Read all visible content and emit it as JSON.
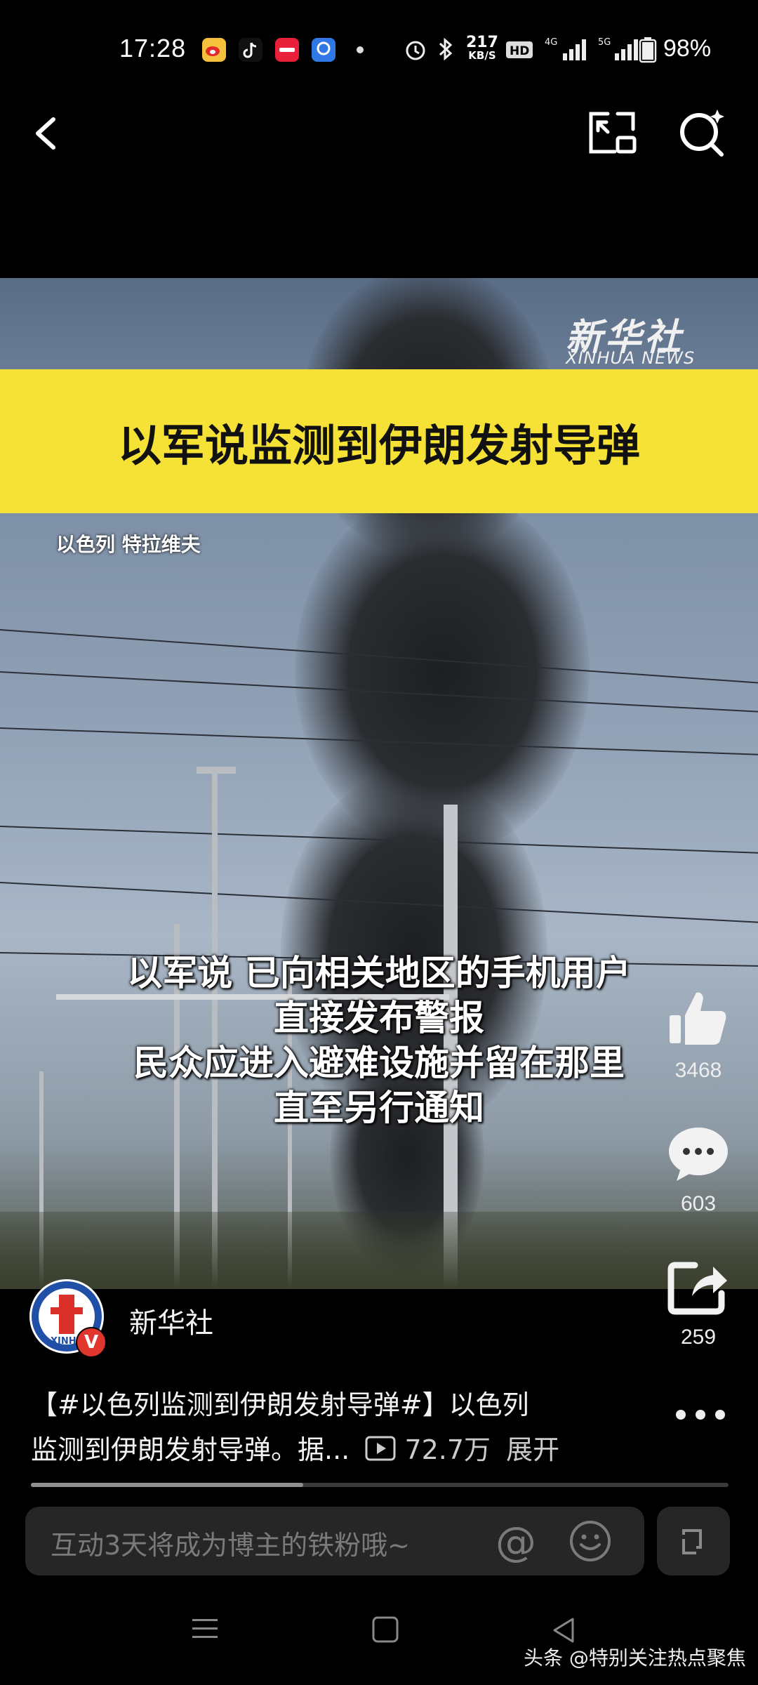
{
  "status_bar": {
    "time": "17:28",
    "net_speed_value": "217",
    "net_speed_unit": "KB/S",
    "battery": "98%"
  },
  "video": {
    "watermark_cn": "新华社",
    "watermark_en": "XINHUA NEWS",
    "headline": "以军说监测到伊朗发射导弹",
    "location": "以色列 特拉维夫",
    "subtitles": [
      "以军说 已向相关地区的手机用户",
      "直接发布警报",
      "民众应进入避难设施并留在那里",
      "直至另行通知"
    ]
  },
  "actions": {
    "like_count": "3468",
    "comment_count": "603",
    "share_count": "259"
  },
  "post": {
    "author": "新华社",
    "verified_badge": "V",
    "desc_line1": "【#以色列监测到伊朗发射导弹#】以色列",
    "desc_line2": "监测到伊朗发射导弹。据...",
    "play_count": "72.7万",
    "expand_label": "展开",
    "progress": 0.39
  },
  "comment_bar": {
    "placeholder": "互动3天将成为博主的铁粉哦~",
    "at_symbol": "@"
  },
  "watermark": "头条 @特别关注热点聚焦"
}
